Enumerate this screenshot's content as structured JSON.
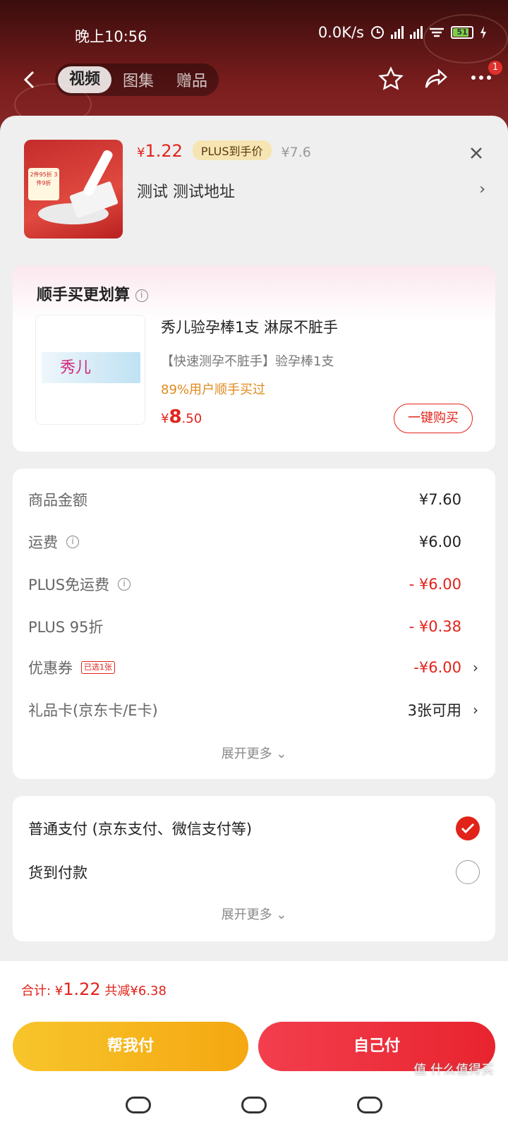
{
  "status_bar": {
    "time": "晚上10:56",
    "speed": "0.0K/s",
    "battery": "51"
  },
  "nav": {
    "tabs": [
      {
        "label": "视频"
      },
      {
        "label": "图集"
      },
      {
        "label": "赠品"
      }
    ],
    "badge": "1"
  },
  "product": {
    "currency": "¥",
    "price": "1.22",
    "plus_tag": "PLUS到手价",
    "original_price": "¥7.6",
    "address": "测试  测试地址",
    "address_arrow": "›",
    "image_tag": "2件95折 3件9折"
  },
  "addon": {
    "title": "顺手买更划算",
    "name": "秀儿验孕棒1支 淋尿不脏手",
    "subtitle": "【快速测孕不脏手】验孕棒1支",
    "stat": "89%用户顺手买过",
    "currency": "¥",
    "price_int": "8",
    "price_dec": ".50",
    "buy_button": "一键购买",
    "pack_brand": "秀儿"
  },
  "summary": {
    "rows": [
      {
        "label": "商品金额",
        "value": "¥7.60"
      },
      {
        "label": "运费",
        "value": "¥6.00"
      },
      {
        "label": "PLUS免运费",
        "value": "- ¥6.00"
      },
      {
        "label": "PLUS 95折",
        "value": "- ¥0.38"
      },
      {
        "label": "优惠券",
        "tag": "已选1张",
        "value": "-¥6.00"
      },
      {
        "label": "礼品卡(京东卡/E卡)",
        "value": "3张可用"
      }
    ],
    "expand": "展开更多 ⌄",
    "chevron": "›"
  },
  "payment": {
    "options": [
      {
        "label": "普通支付 (京东支付、微信支付等)",
        "selected": true
      },
      {
        "label": "货到付款",
        "selected": false
      }
    ],
    "expand": "展开更多 ⌄"
  },
  "footer": {
    "total_label": "合计: ",
    "total_currency": "¥",
    "total_value": "1.22",
    "discount": " 共减¥6.38",
    "help_pay": "帮我付",
    "self_pay": "自己付"
  },
  "watermark": "值 什么值得买"
}
